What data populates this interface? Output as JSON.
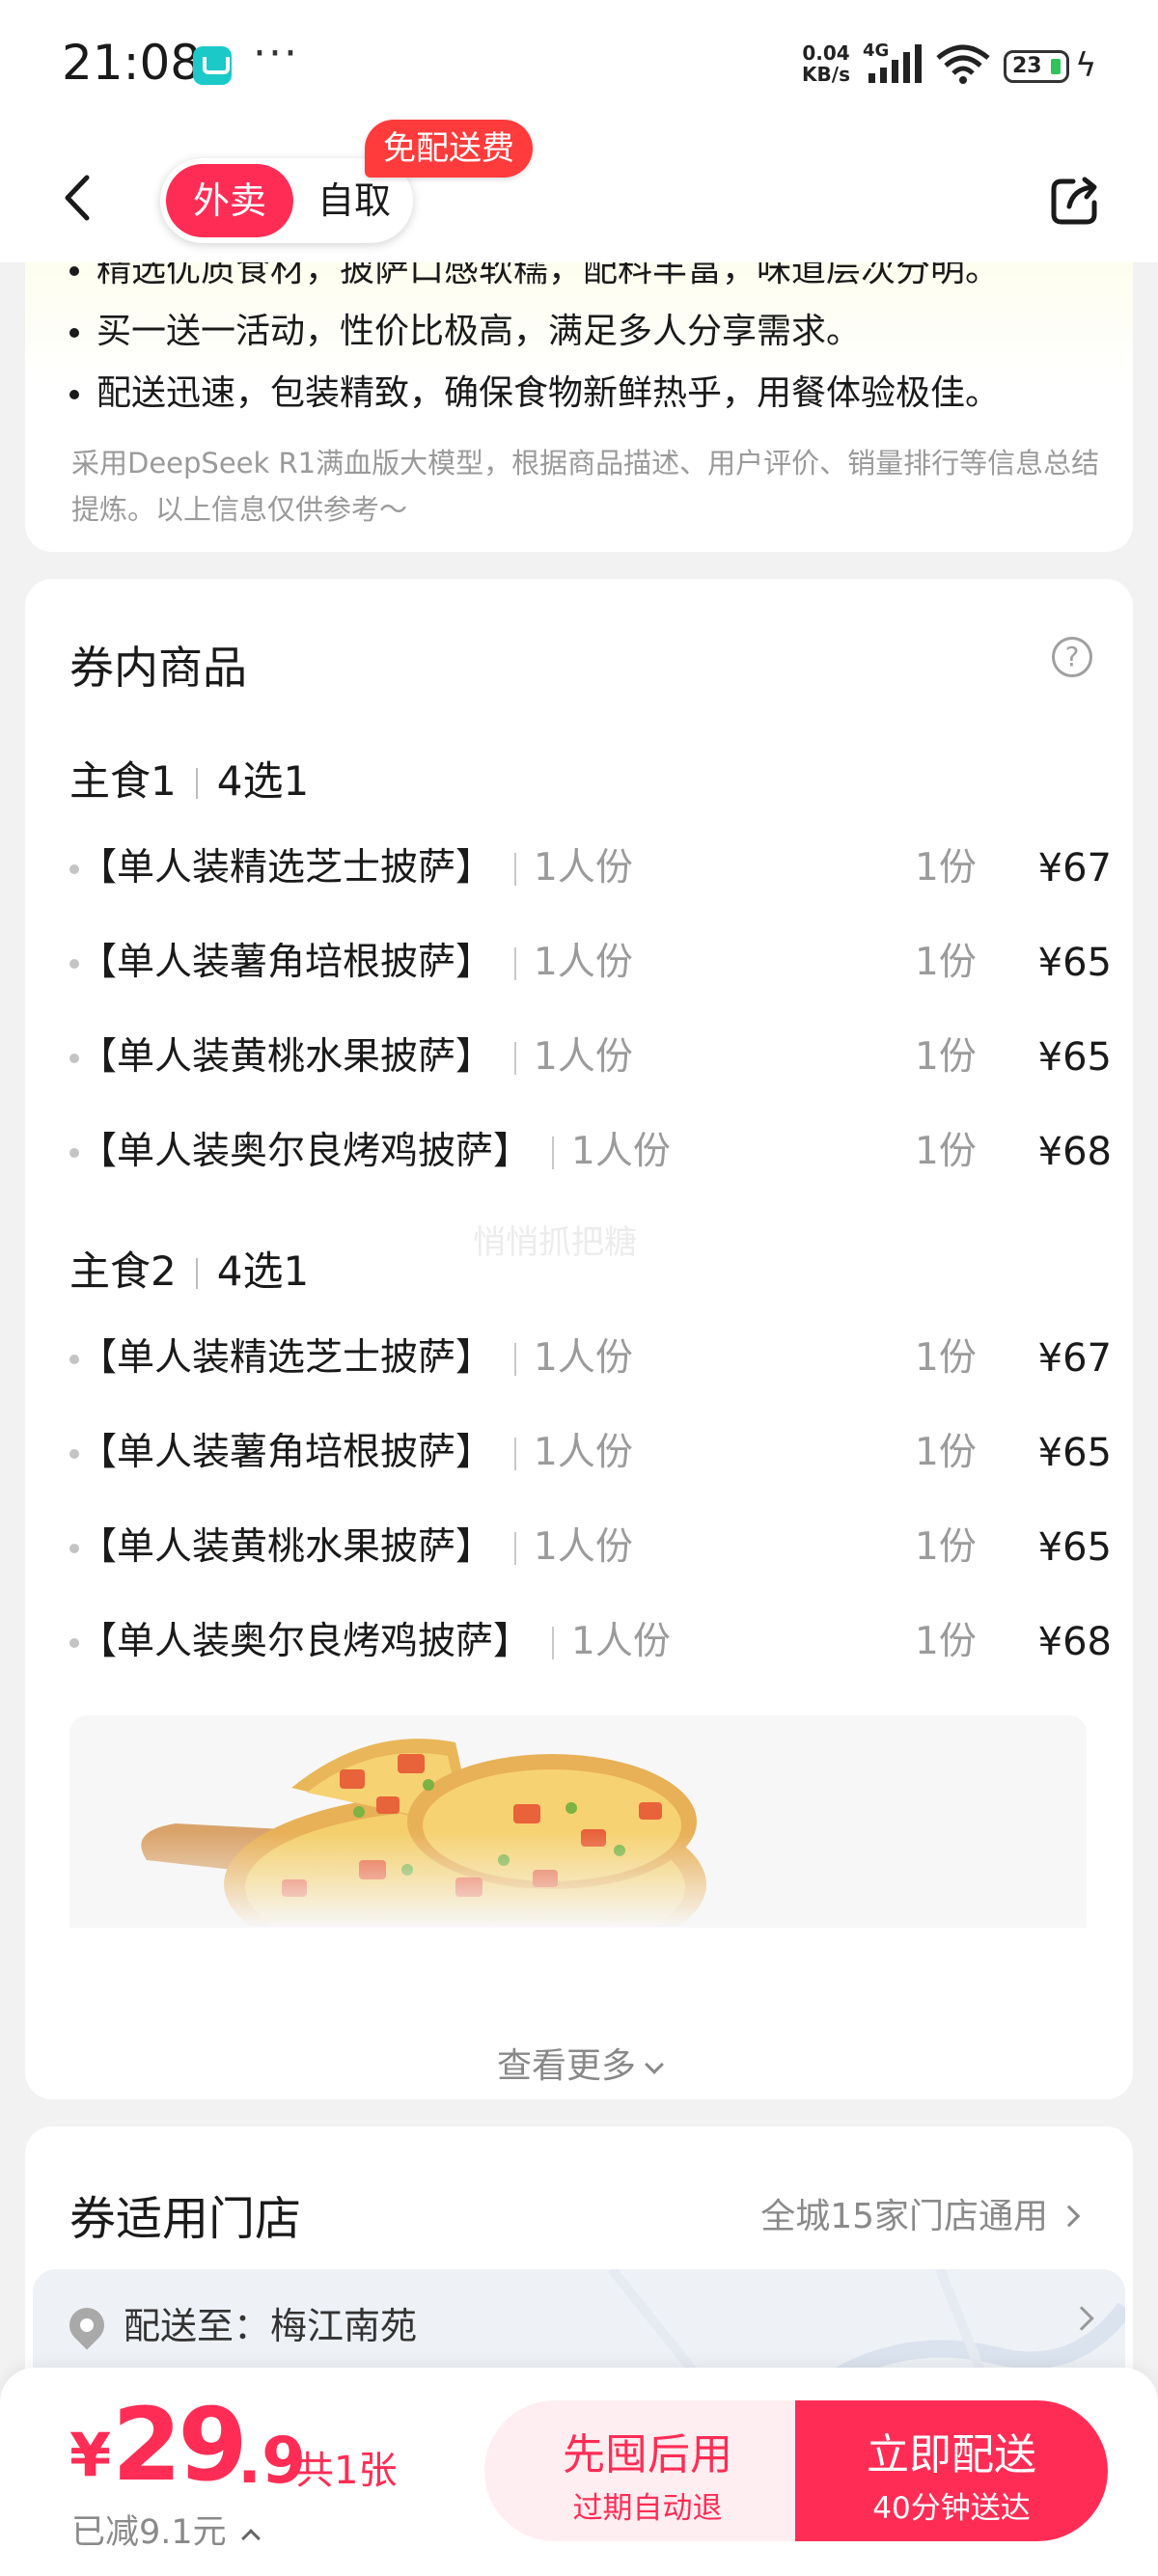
{
  "status_bar": {
    "time": "21:08",
    "more": "···",
    "net_speed_value": "0.04",
    "net_speed_unit": "KB/s",
    "network": "4G",
    "battery": "23"
  },
  "header": {
    "tabs": [
      {
        "label": "外卖",
        "active": true
      },
      {
        "label": "自取",
        "active": false
      }
    ],
    "badge": "免配送费"
  },
  "summary": {
    "lines": [
      "精选优质食材，披萨口感软糯，配料丰富，味道层次分明。",
      "买一送一活动，性价比极高，满足多人分享需求。",
      "配送迅速，包装精致，确保食物新鲜热乎，用餐体验极佳。"
    ],
    "disclaimer": "采用DeepSeek R1满血版大模型，根据商品描述、用户评价、销量排行等信息总结提炼。以上信息仅供参考～"
  },
  "coupon_items": {
    "title": "券内商品",
    "help_icon": "?",
    "groups": [
      {
        "name": "主食1",
        "rule": "4选1",
        "items": [
          {
            "name": "【单人装精选芝士披萨】",
            "spec": "1人份",
            "qty": "1份",
            "price": "¥67"
          },
          {
            "name": "【单人装薯角培根披萨】",
            "spec": "1人份",
            "qty": "1份",
            "price": "¥65"
          },
          {
            "name": "【单人装黄桃水果披萨】",
            "spec": "1人份",
            "qty": "1份",
            "price": "¥65"
          },
          {
            "name": "【单人装奥尔良烤鸡披萨】",
            "spec": "1人份",
            "qty": "1份",
            "price": "¥68"
          }
        ]
      },
      {
        "name": "主食2",
        "rule": "4选1",
        "items": [
          {
            "name": "【单人装精选芝士披萨】",
            "spec": "1人份",
            "qty": "1份",
            "price": "¥67"
          },
          {
            "name": "【单人装薯角培根披萨】",
            "spec": "1人份",
            "qty": "1份",
            "price": "¥65"
          },
          {
            "name": "【单人装黄桃水果披萨】",
            "spec": "1人份",
            "qty": "1份",
            "price": "¥65"
          },
          {
            "name": "【单人装奥尔良烤鸡披萨】",
            "spec": "1人份",
            "qty": "1份",
            "price": "¥68"
          }
        ]
      }
    ],
    "watermark": "悄悄抓把糖",
    "see_more": "查看更多"
  },
  "stores": {
    "title": "券适用门店",
    "link": "全城15家门店通用",
    "delivery_prefix": "配送至：",
    "delivery_address": "梅江南苑"
  },
  "bottom_bar": {
    "currency": "¥",
    "price_int": "29",
    "price_dec": ".9",
    "count": "共1张",
    "saved": "已减9.1元",
    "btn_later": "先囤后用",
    "btn_later_sub": "过期自动退",
    "btn_now": "立即配送",
    "btn_now_sub": "40分钟送达"
  },
  "colors": {
    "accent": "#ff2d55",
    "badge": "#ff3b3b",
    "muted": "#9b9b9b"
  },
  "icons": [
    "app-icon",
    "signal-icon",
    "wifi-icon",
    "battery-icon",
    "back-arrow-icon",
    "share-icon",
    "help-icon",
    "chevron-down-icon",
    "chevron-right-icon",
    "location-pin-icon",
    "chevron-up-icon"
  ]
}
